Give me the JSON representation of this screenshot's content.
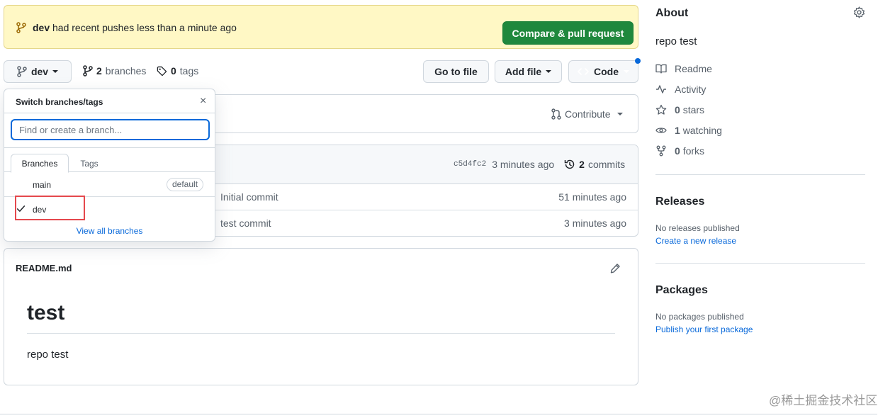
{
  "banner": {
    "branch": "dev",
    "message": "had recent pushes less than a minute ago",
    "compare_label": "Compare & pull request"
  },
  "toolbar": {
    "current_branch": "dev",
    "branches_count": "2",
    "branches_label": "branches",
    "tags_count": "0",
    "tags_label": "tags",
    "go_to_file": "Go to file",
    "add_file": "Add file",
    "code": "Code"
  },
  "contribute": {
    "label": "Contribute"
  },
  "latest_commit": {
    "sha": "c5d4fc2",
    "time": "3 minutes ago",
    "commits_count": "2",
    "commits_label": "commits"
  },
  "file_rows": [
    {
      "message": "Initial commit",
      "time": "51 minutes ago"
    },
    {
      "message": "test commit",
      "time": "3 minutes ago"
    }
  ],
  "readme": {
    "filename": "README.md",
    "heading": "test",
    "body": "repo test"
  },
  "dropdown": {
    "title": "Switch branches/tags",
    "close": "×",
    "placeholder": "Find or create a branch...",
    "tabs": [
      "Branches",
      "Tags"
    ],
    "branches": [
      {
        "name": "main",
        "badge": "default"
      },
      {
        "name": "dev",
        "selected": true
      }
    ],
    "view_all": "View all branches"
  },
  "sidebar": {
    "about_title": "About",
    "description": "repo test",
    "items": [
      {
        "icon": "book-icon",
        "label": "Readme"
      },
      {
        "icon": "pulse-icon",
        "label": "Activity"
      },
      {
        "icon": "star-icon",
        "count": "0",
        "label": "stars"
      },
      {
        "icon": "eye-icon",
        "count": "1",
        "label": "watching"
      },
      {
        "icon": "fork-icon",
        "count": "0",
        "label": "forks"
      }
    ],
    "releases_title": "Releases",
    "releases_empty": "No releases published",
    "releases_link": "Create a new release",
    "packages_title": "Packages",
    "packages_empty": "No packages published",
    "packages_link": "Publish your first package"
  },
  "watermark": "@稀土掘金技术社区",
  "colors": {
    "banner_bg": "#fff8c5",
    "primary_green": "#1f883d",
    "link_blue": "#0969da",
    "highlight_red": "#e5484d"
  }
}
